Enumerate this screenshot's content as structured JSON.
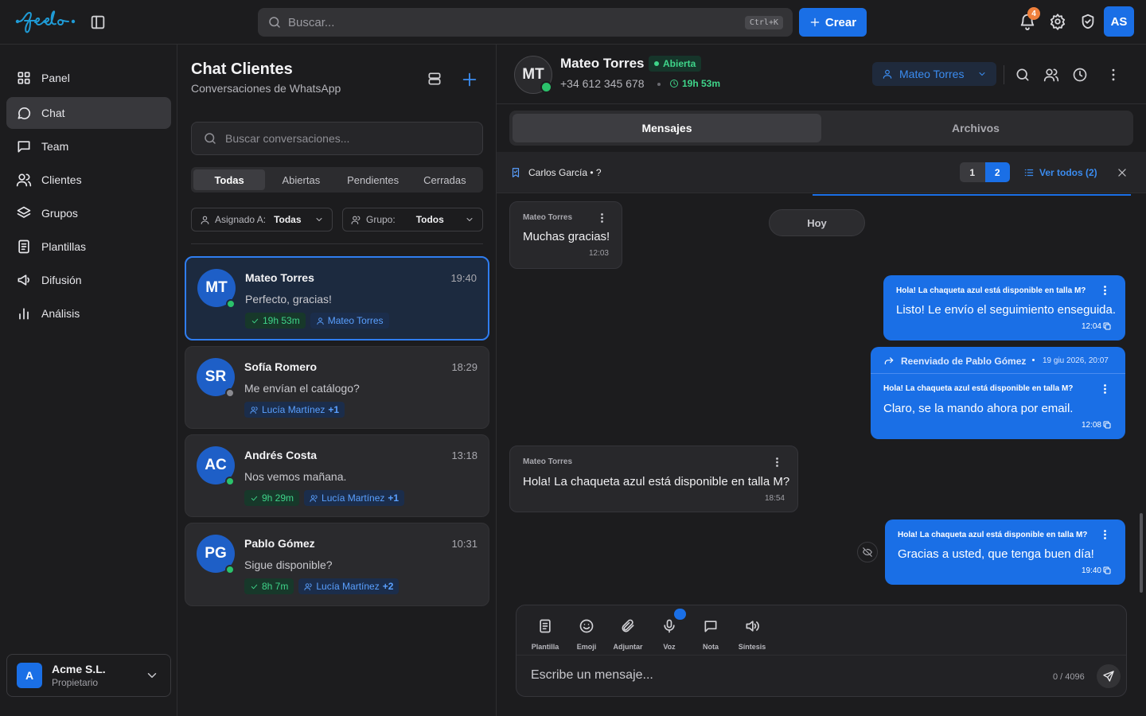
{
  "app": {
    "logo": "feelo",
    "search_placeholder": "Buscar...",
    "search_shortcut": "Ctrl+K",
    "create_label": "Crear",
    "notif_count": "4",
    "user_initials": "AS"
  },
  "nav": {
    "items": [
      {
        "label": "Panel",
        "icon": "grid-icon"
      },
      {
        "label": "Chat",
        "icon": "chat-icon"
      },
      {
        "label": "Team",
        "icon": "message-square-icon"
      },
      {
        "label": "Clientes",
        "icon": "users-icon"
      },
      {
        "label": "Grupos",
        "icon": "layers-icon"
      },
      {
        "label": "Plantillas",
        "icon": "file-text-icon"
      },
      {
        "label": "Difusión",
        "icon": "megaphone-icon"
      },
      {
        "label": "Análisis",
        "icon": "bar-chart-icon"
      }
    ],
    "active": "Chat"
  },
  "workspace": {
    "initial": "A",
    "name": "Acme S.L.",
    "role": "Propietario"
  },
  "list": {
    "title": "Chat Clientes",
    "subtitle": "Conversaciones de WhatsApp",
    "search_placeholder": "Buscar conversaciones...",
    "tabs": [
      "Todas",
      "Abiertas",
      "Pendientes",
      "Cerradas"
    ],
    "active_tab": "Todas",
    "filter_assigned_label": "Asignado A:",
    "filter_assigned_value": "Todas",
    "filter_group_label": "Grupo:",
    "filter_group_value": "Todos",
    "conversations": [
      {
        "initials": "MT",
        "name": "Mateo Torres",
        "time": "19:40",
        "preview": "Perfecto, gracias!",
        "timer": "19h 53m",
        "agent": "Mateo Torres",
        "extra": "",
        "online": true
      },
      {
        "initials": "SR",
        "name": "Sofía Romero",
        "time": "18:29",
        "preview": "Me envían el catálogo?",
        "timer": "",
        "agent": "Lucía Martínez",
        "extra": "+1",
        "online": false
      },
      {
        "initials": "AC",
        "name": "Andrés Costa",
        "time": "13:18",
        "preview": "Nos vemos mañana.",
        "timer": "9h 29m",
        "agent": "Lucía Martínez",
        "extra": "+1",
        "online": true
      },
      {
        "initials": "PG",
        "name": "Pablo Gómez",
        "time": "10:31",
        "preview": "Sigue disponible?",
        "timer": "8h 7m",
        "agent": "Lucía Martínez",
        "extra": "+2",
        "online": true
      }
    ]
  },
  "chat": {
    "initials": "MT",
    "name": "Mateo Torres",
    "status": "Abierta",
    "phone": "+34 612 345 678",
    "timer": "19h 53m",
    "assignee": "Mateo Torres",
    "tabs": [
      "Mensajes",
      "Archivos"
    ],
    "active_tab": "Mensajes",
    "pinned_by": "Carlos García  •  ?",
    "pager": [
      "1",
      "2"
    ],
    "pager_active": "2",
    "view_all": "Ver todos (2)",
    "day_label": "Hoy",
    "messages": [
      {
        "dir": "in",
        "author": "Mateo Torres",
        "text": "Muchas gracias!",
        "time": "12:03"
      },
      {
        "dir": "out",
        "quote": "Hola! La chaqueta azul está disponible en talla M?",
        "text": "Listo! Le envío el seguimiento enseguida.",
        "time": "12:04"
      },
      {
        "dir": "out",
        "forwarded": "Reenviado de Pablo Gómez",
        "forwarded_date": "19 giu 2026, 20:07",
        "quote": "Hola! La chaqueta azul está disponible en talla M?",
        "text": "Claro, se la mando ahora por email.",
        "time": "12:08"
      },
      {
        "dir": "in",
        "author": "Mateo Torres",
        "text": "Hola! La chaqueta azul está disponible en talla M?",
        "time": "18:54"
      },
      {
        "dir": "out",
        "quote": "Hola! La chaqueta azul está disponible en talla M?",
        "text": "Gracias a usted, que tenga buen día!",
        "time": "19:40"
      }
    ]
  },
  "composer": {
    "tools": [
      "Plantilla",
      "Emoji",
      "Adjuntar",
      "Voz",
      "Nota",
      "Síntesis"
    ],
    "placeholder": "Escribe un mensaje...",
    "counter": "0 / 4096"
  },
  "colors": {
    "accent": "#1a6fe6",
    "online": "#2bc26b",
    "background": "#1c1c1e"
  }
}
